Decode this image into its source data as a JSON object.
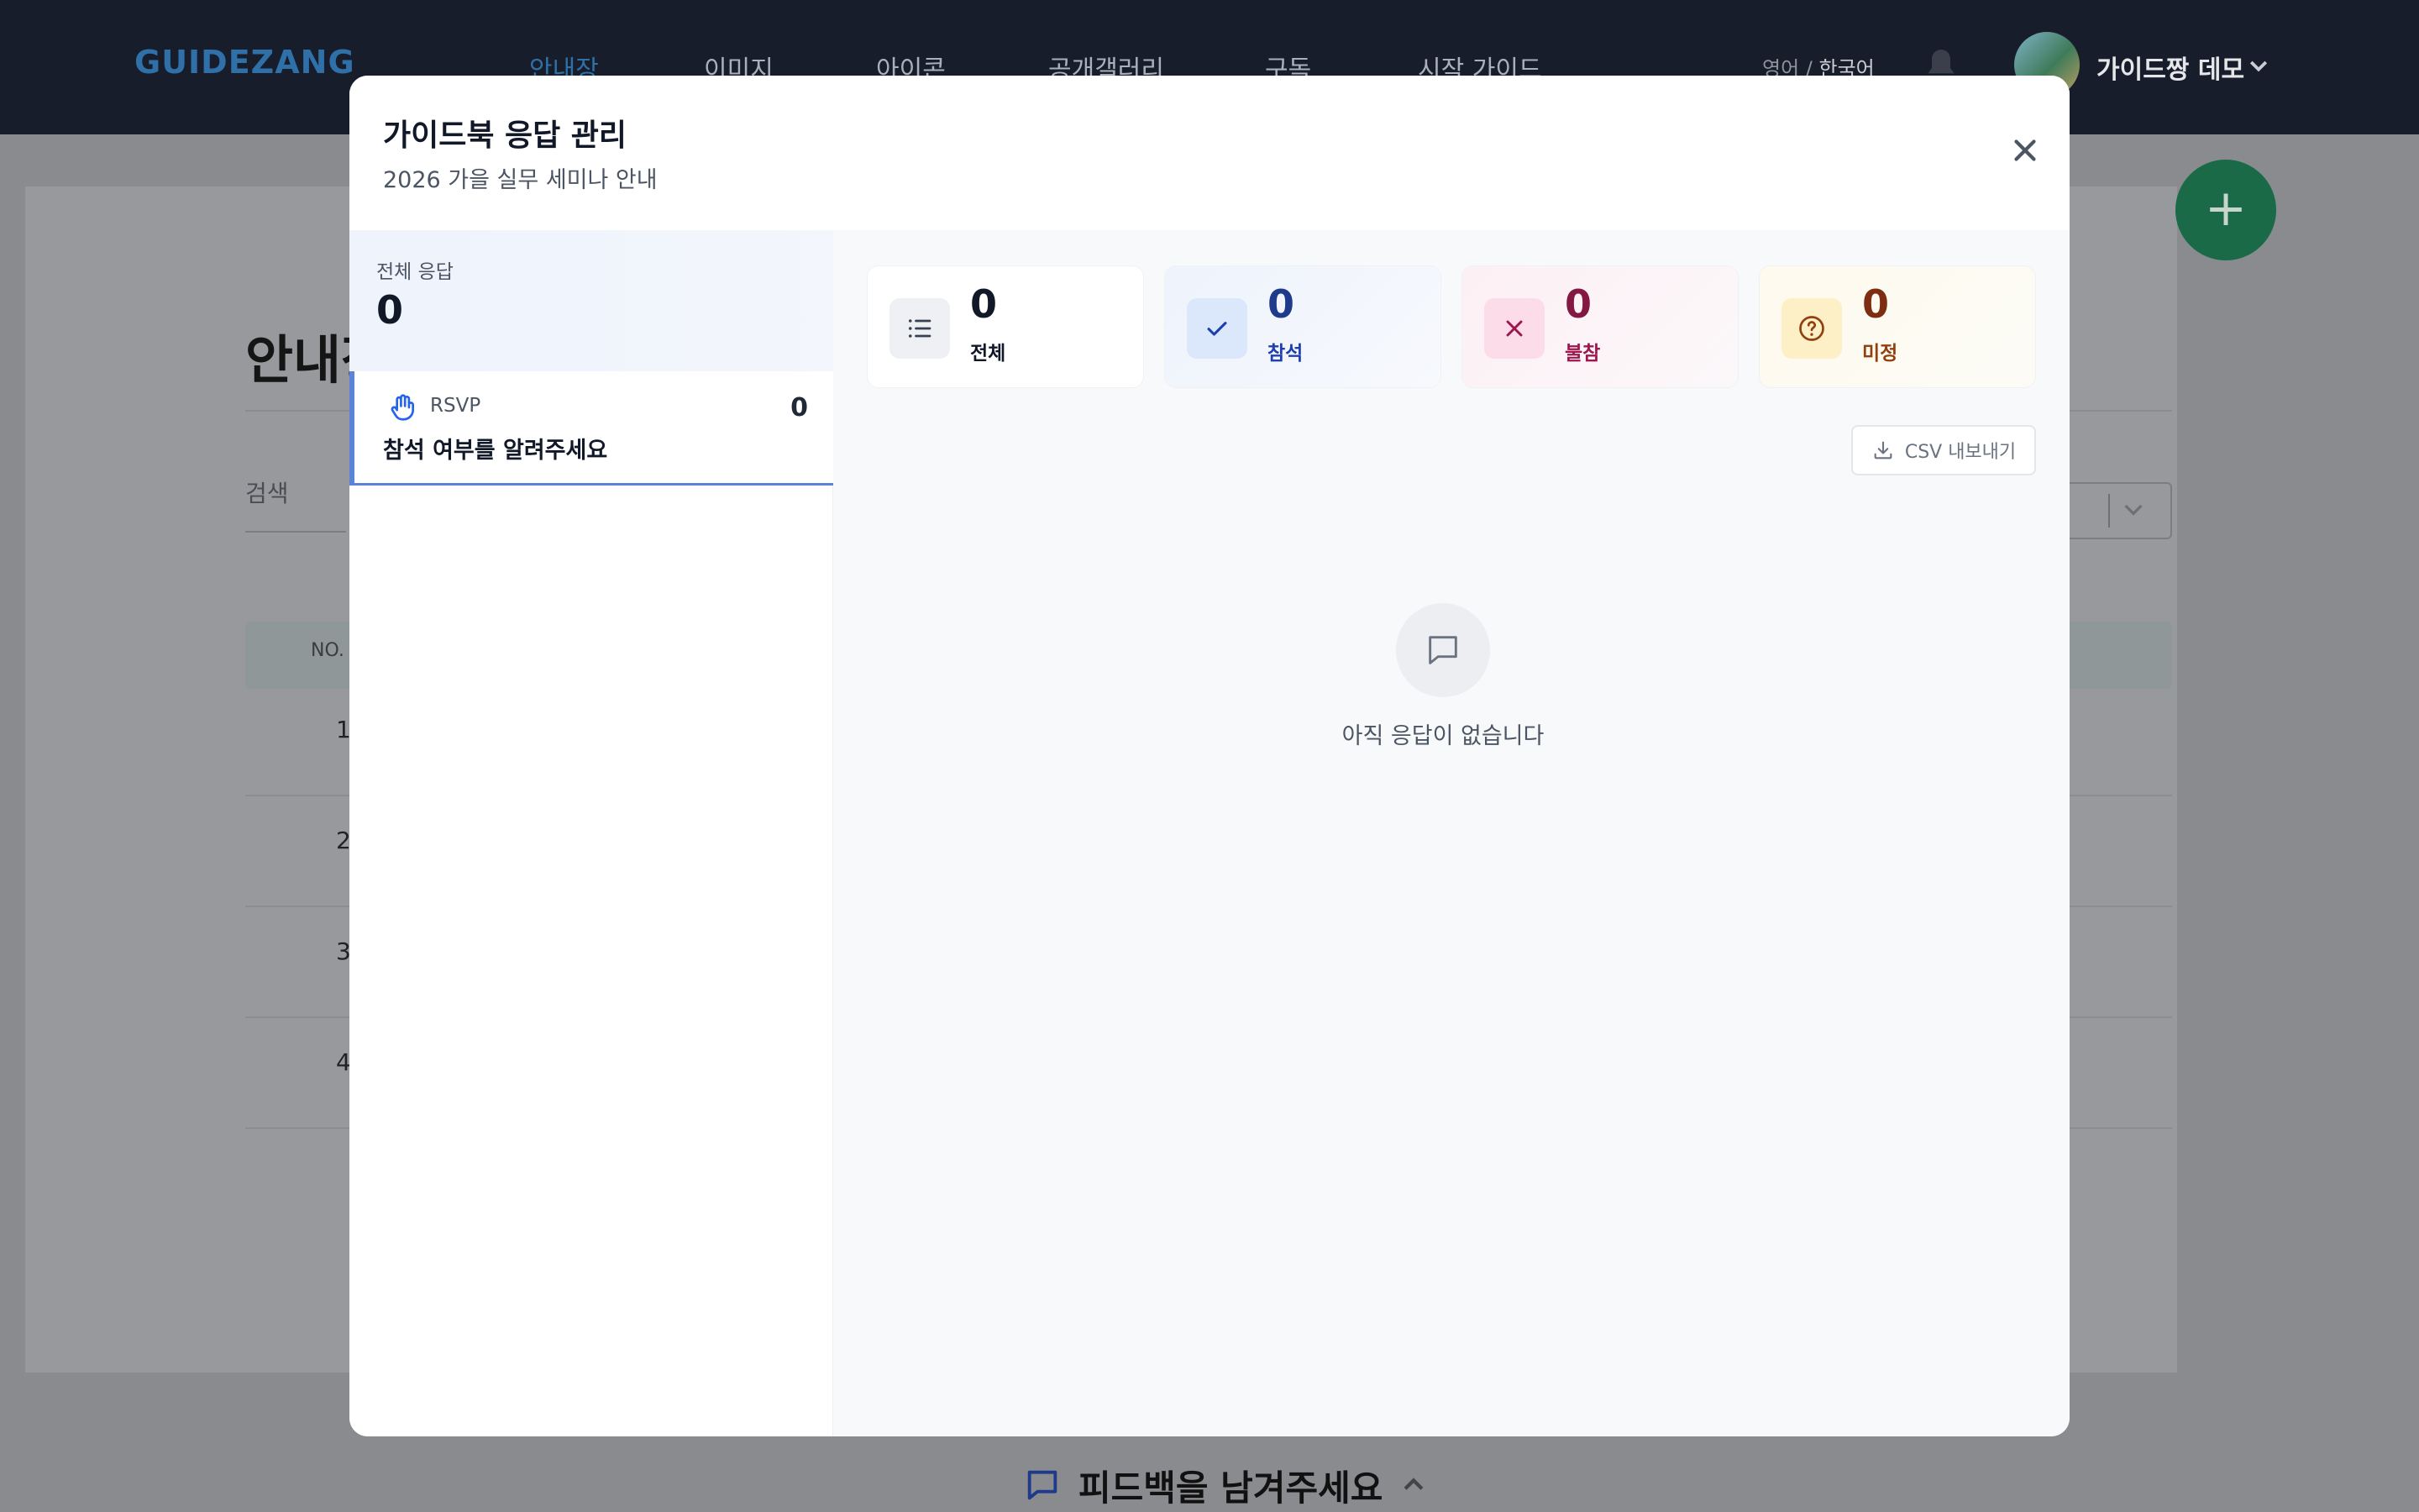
{
  "app": {
    "logo": "GUIDEZANG"
  },
  "nav": {
    "items": [
      "안내장",
      "이미지",
      "아이콘",
      "공개갤러리",
      "구독",
      "시작 가이드"
    ],
    "lang_inactive": "영어",
    "lang_separator": " / ",
    "lang_active": "한국어",
    "user_name": "가이드짱 데모"
  },
  "background": {
    "page_title": "안내장",
    "search_placeholder": "검색",
    "table_header_no": "NO.",
    "row_numbers": [
      "1",
      "2",
      "3",
      "4"
    ],
    "fab_label": "+",
    "feedback_text": "피드백을 남겨주세요"
  },
  "modal": {
    "title": "가이드북 응답 관리",
    "subtitle": "2026 가을 실무 세미나 안내",
    "sidebar": {
      "total_label": "전체 응답",
      "total_count": "0",
      "question": {
        "type": "RSVP",
        "label": "참석 여부를 알려주세요",
        "count": "0"
      }
    },
    "stats": [
      {
        "count": "0",
        "label": "전체",
        "icon": "list-icon",
        "color": "#111827",
        "label_color": "#111827"
      },
      {
        "count": "0",
        "label": "참석",
        "icon": "check-icon",
        "color": "#1e3a8a",
        "label_color": "#1e40af"
      },
      {
        "count": "0",
        "label": "불참",
        "icon": "x-icon",
        "color": "#831843",
        "label_color": "#9d174d"
      },
      {
        "count": "0",
        "label": "미정",
        "icon": "question-circle-icon",
        "color": "#7c2d12",
        "label_color": "#92400e"
      }
    ],
    "csv_export_label": "CSV 내보내기",
    "empty_message": "아직 응답이 없습니다"
  },
  "colors": {
    "nav_bg": "#171d2b",
    "brand": "#2f70a8",
    "fab": "#1a6a48",
    "accent_border": "#5b84d9"
  }
}
